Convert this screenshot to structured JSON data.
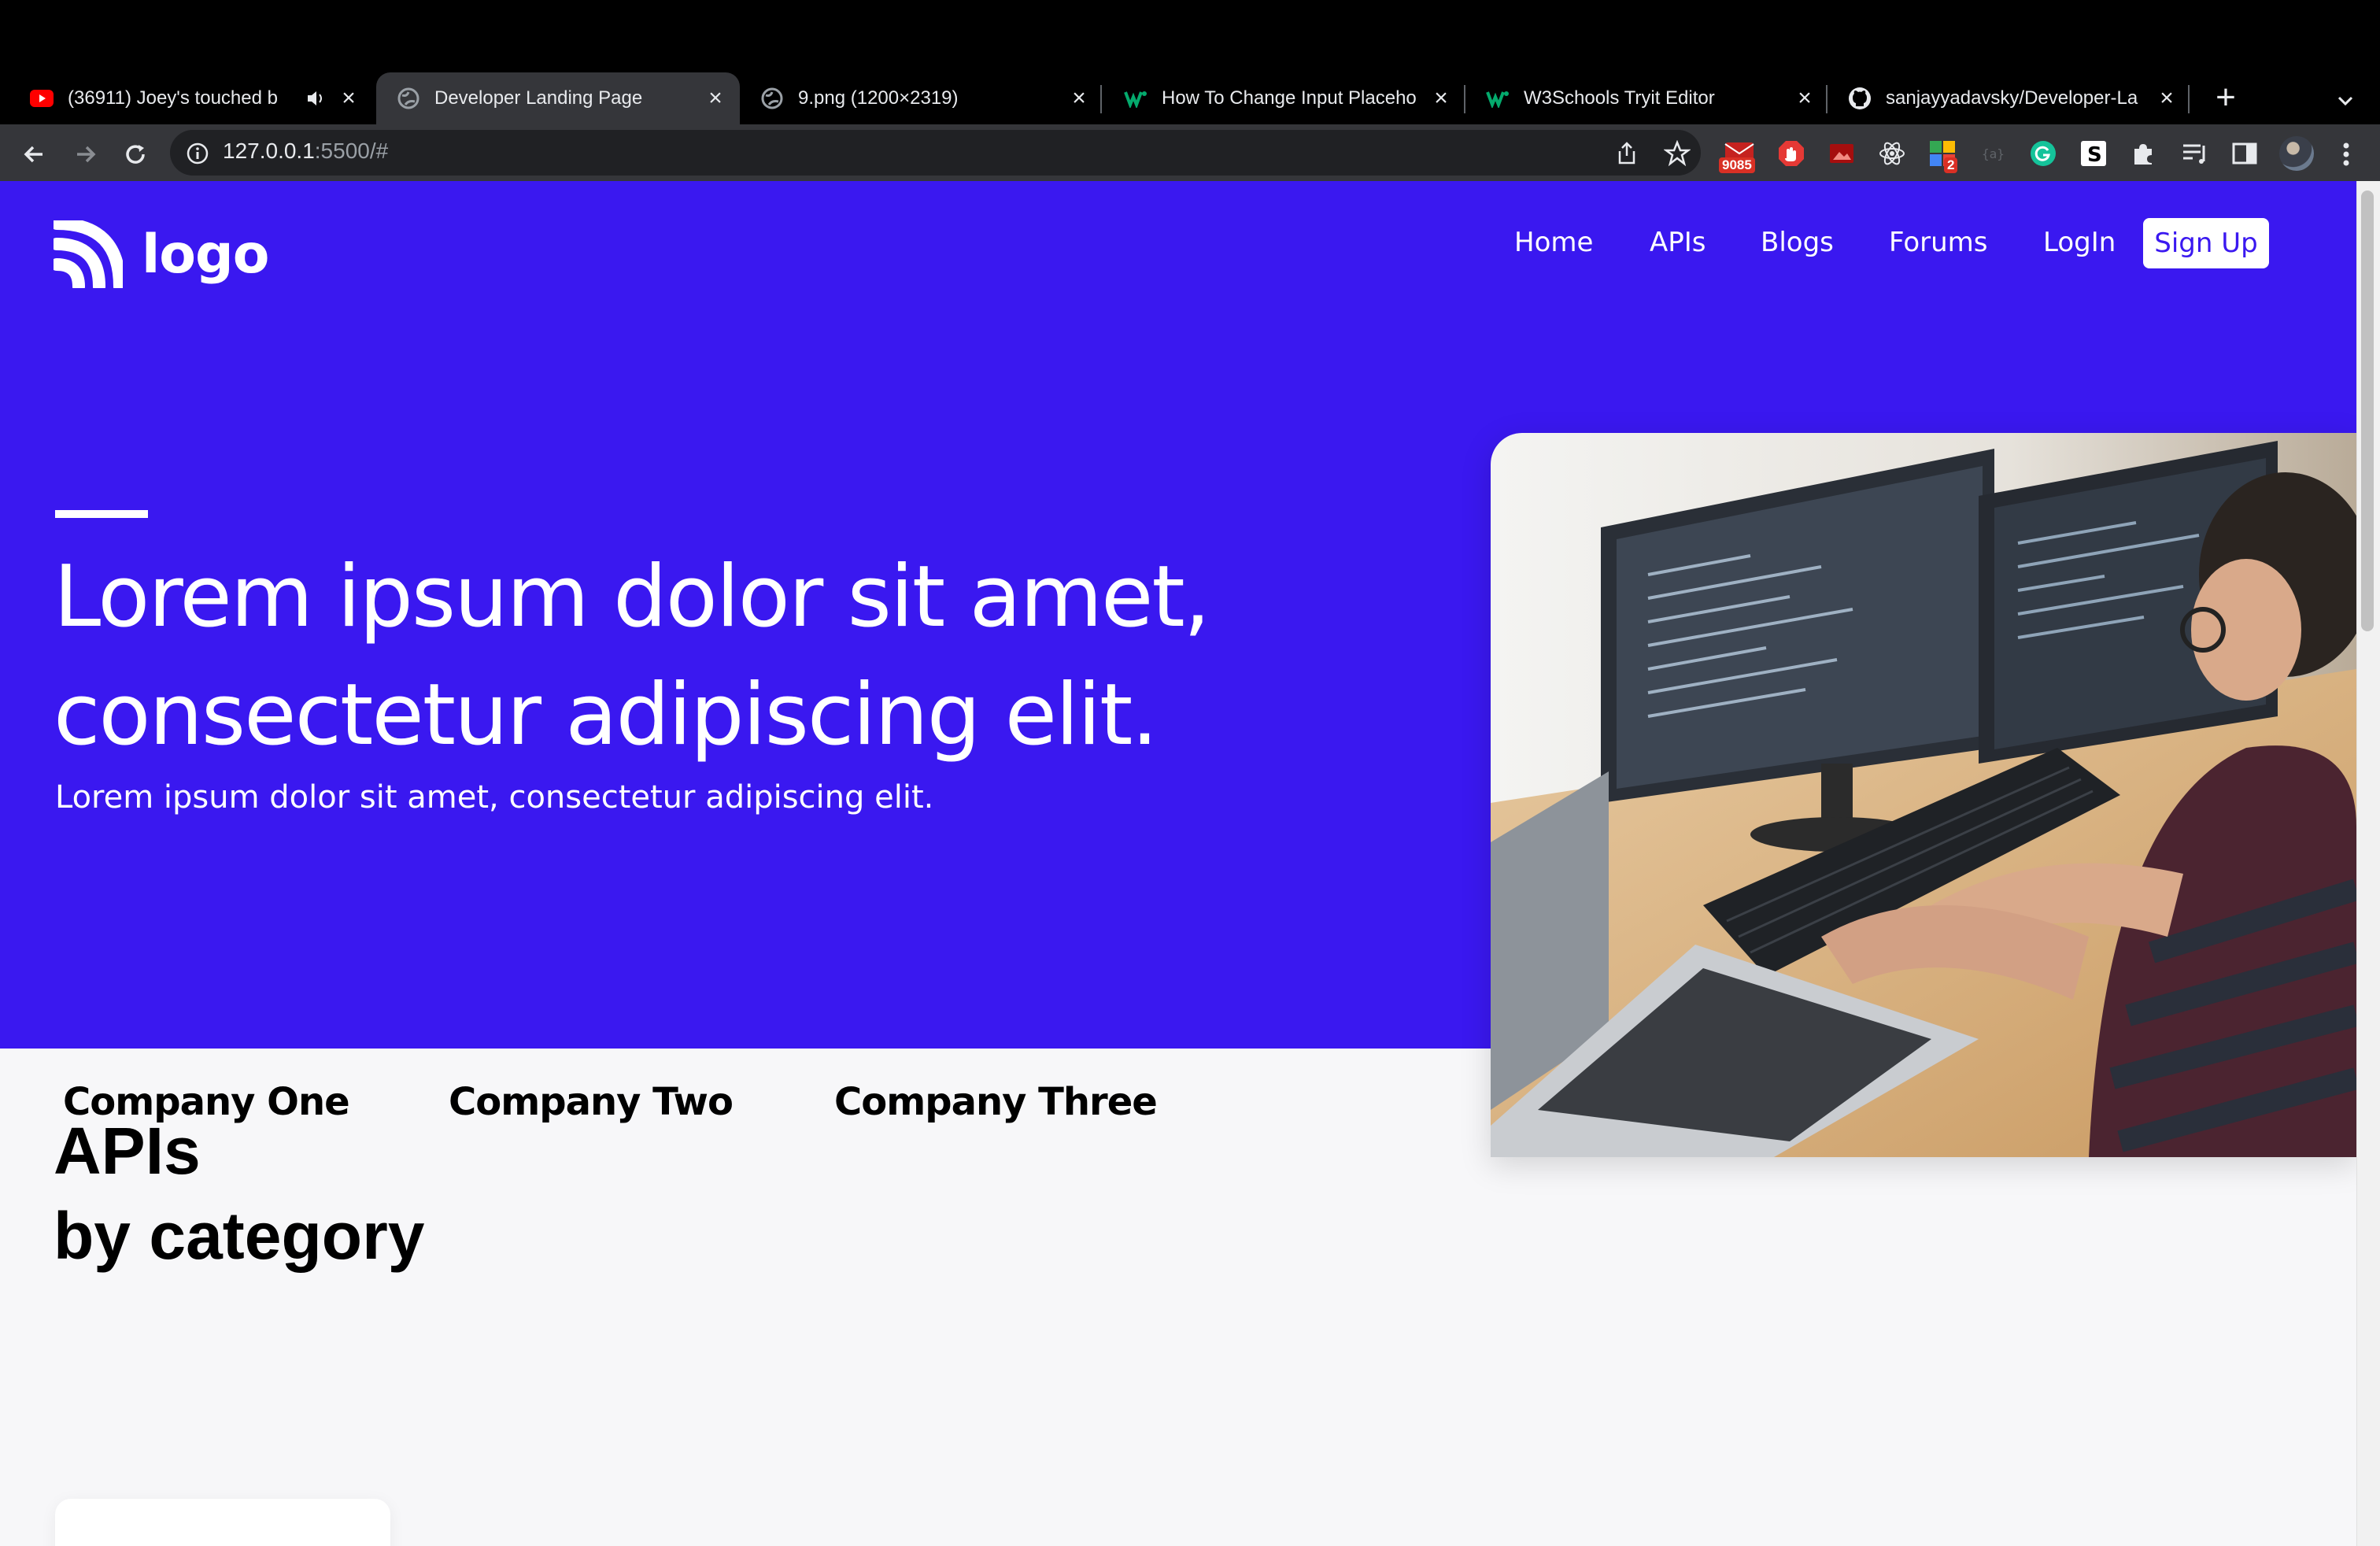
{
  "browser": {
    "tabs": [
      {
        "title": "(36911) Joey's touched b",
        "favicon": "youtube-icon",
        "muted_icon": "speaker-icon"
      },
      {
        "title": "Developer Landing Page",
        "favicon": "globe-icon",
        "active": true
      },
      {
        "title": "9.png (1200×2319)",
        "favicon": "globe-icon"
      },
      {
        "title": "How To Change Input Placeho",
        "favicon": "w3schools-icon"
      },
      {
        "title": "W3Schools Tryit Editor",
        "favicon": "w3schools-icon"
      },
      {
        "title": "sanjayyadavsky/Developer-La",
        "favicon": "github-icon"
      }
    ],
    "url_host": "127.0.0.1",
    "url_rest": ":5500/#",
    "extension_badge_mail": "9085",
    "extension_badge_count": "2"
  },
  "page": {
    "logo_text": "logo",
    "nav": {
      "home": "Home",
      "apis": "APIs",
      "blogs": "Blogs",
      "forums": "Forums",
      "login": "LogIn",
      "signup": "Sign Up"
    },
    "hero": {
      "title_line1": "Lorem ipsum dolor sit amet,",
      "title_line2": "consectetur adipiscing elit.",
      "subtitle": "Lorem ipsum dolor sit amet, consectetur adipiscing elit."
    },
    "companies": [
      "Company One",
      "Company Two",
      "Company Three"
    ],
    "apis_title_line1": "APIs",
    "apis_title_line2": "by category"
  },
  "colors": {
    "brand": "#3a18f0",
    "page_bg": "#f7f7f9"
  }
}
